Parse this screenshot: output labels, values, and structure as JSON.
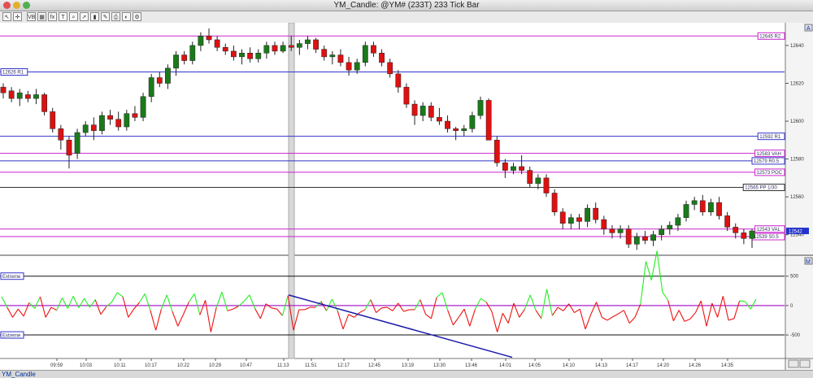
{
  "window": {
    "title": "YM_Candle: @YM# (233T) 233 Tick Bar"
  },
  "toolbar": {
    "buttons": [
      "cursor-icon",
      "crosshair-icon",
      "volume-bars-icon",
      "grid-icon",
      "fx-icon",
      "text-tool-icon",
      "zoom-icon",
      "arrow-icon",
      "bar-icon",
      "palette-icon",
      "print-icon",
      "color-icon",
      "gear-icon"
    ],
    "vb_label": "VB"
  },
  "status": {
    "tab_label": "YM_Candle"
  },
  "colors": {
    "up": "#1a7a1a",
    "down": "#dd1111",
    "osc_up": "#22ee22",
    "osc_down": "#ee1111",
    "pivot_blue": "#3333cc",
    "pivot_magenta": "#cc22cc"
  },
  "chart_data": [
    {
      "type": "candlestick",
      "ylim": [
        12530,
        12652
      ],
      "y_ticks": [
        12540,
        12560,
        12580,
        12600,
        12620,
        12640
      ],
      "x_tick_labels": [
        "09:59",
        "10:03",
        "10:11",
        "10:17",
        "10:22",
        "10:29",
        "10:47",
        "11:13",
        "11:51",
        "12:17",
        "12:45",
        "13:19",
        "13:30",
        "13:46",
        "14:01",
        "14:05",
        "14:10",
        "14:13",
        "14:17",
        "14:20",
        "14:26",
        "14:35"
      ],
      "levels": [
        {
          "label": "12645 R2",
          "value": 12645,
          "color": "#cc22cc"
        },
        {
          "label": "12626 R1",
          "value": 12626,
          "color": "#3333cc"
        },
        {
          "label": "12592 R1",
          "value": 12592,
          "color": "#3333cc"
        },
        {
          "label": "12583 VAH",
          "value": 12583,
          "color": "#cc22cc"
        },
        {
          "label": "12579 R0.5",
          "value": 12579,
          "color": "#3333cc"
        },
        {
          "label": "12573 POC",
          "value": 12573,
          "color": "#cc22cc"
        },
        {
          "label": "12565 PP 1/30",
          "value": 12565,
          "color": "#333333"
        },
        {
          "label": "12543 VAL",
          "value": 12543,
          "color": "#cc22cc"
        },
        {
          "label": "12539 S0.5",
          "value": 12539,
          "color": "#cc22cc"
        }
      ],
      "last_price": "12542",
      "axis_marker_top": "A",
      "candles": [
        [
          12618,
          12620,
          12612,
          12615
        ],
        [
          12616,
          12618,
          12610,
          12612
        ],
        [
          12612,
          12617,
          12608,
          12615
        ],
        [
          12614,
          12616,
          12610,
          12612
        ],
        [
          12612,
          12617,
          12609,
          12614
        ],
        [
          12614,
          12615,
          12603,
          12605
        ],
        [
          12605,
          12607,
          12594,
          12596
        ],
        [
          12596,
          12598,
          12585,
          12590
        ],
        [
          12590,
          12592,
          12575,
          12582
        ],
        [
          12583,
          12596,
          12580,
          12594
        ],
        [
          12594,
          12600,
          12592,
          12598
        ],
        [
          12598,
          12602,
          12590,
          12595
        ],
        [
          12595,
          12605,
          12593,
          12603
        ],
        [
          12603,
          12606,
          12598,
          12601
        ],
        [
          12601,
          12605,
          12595,
          12597
        ],
        [
          12597,
          12606,
          12595,
          12604
        ],
        [
          12604,
          12608,
          12600,
          12602
        ],
        [
          12602,
          12615,
          12600,
          12613
        ],
        [
          12613,
          12625,
          12610,
          12623
        ],
        [
          12623,
          12626,
          12618,
          12620
        ],
        [
          12620,
          12630,
          12617,
          12628
        ],
        [
          12628,
          12637,
          12624,
          12635
        ],
        [
          12635,
          12637,
          12630,
          12632
        ],
        [
          12632,
          12642,
          12630,
          12640
        ],
        [
          12640,
          12647,
          12637,
          12645
        ],
        [
          12645,
          12649,
          12641,
          12643
        ],
        [
          12643,
          12645,
          12637,
          12639
        ],
        [
          12639,
          12641,
          12635,
          12637
        ],
        [
          12637,
          12640,
          12632,
          12634
        ],
        [
          12634,
          12638,
          12630,
          12636
        ],
        [
          12636,
          12639,
          12631,
          12633
        ],
        [
          12633,
          12638,
          12631,
          12636
        ],
        [
          12636,
          12642,
          12633,
          12640
        ],
        [
          12640,
          12642,
          12635,
          12637
        ],
        [
          12637,
          12642,
          12636,
          12640
        ],
        [
          12640,
          12645,
          12637,
          12639
        ],
        [
          12639,
          12643,
          12635,
          12641
        ],
        [
          12641,
          12645,
          12638,
          12643
        ],
        [
          12643,
          12644,
          12636,
          12638
        ],
        [
          12638,
          12640,
          12632,
          12634
        ],
        [
          12634,
          12637,
          12630,
          12635
        ],
        [
          12635,
          12638,
          12629,
          12631
        ],
        [
          12631,
          12634,
          12624,
          12627
        ],
        [
          12627,
          12633,
          12625,
          12631
        ],
        [
          12631,
          12642,
          12629,
          12640
        ],
        [
          12640,
          12642,
          12634,
          12636
        ],
        [
          12636,
          12638,
          12629,
          12631
        ],
        [
          12631,
          12633,
          12623,
          12625
        ],
        [
          12625,
          12627,
          12615,
          12618
        ],
        [
          12618,
          12620,
          12607,
          12609
        ],
        [
          12609,
          12611,
          12598,
          12603
        ],
        [
          12603,
          12610,
          12600,
          12608
        ],
        [
          12608,
          12610,
          12600,
          12602
        ],
        [
          12602,
          12607,
          12598,
          12600
        ],
        [
          12600,
          12603,
          12594,
          12596
        ],
        [
          12596,
          12597,
          12590,
          12595
        ],
        [
          12595,
          12598,
          12592,
          12596
        ],
        [
          12596,
          12605,
          12594,
          12603
        ],
        [
          12603,
          12613,
          12601,
          12611
        ],
        [
          12611,
          12612,
          12590,
          12590
        ],
        [
          12590,
          12592,
          12576,
          12578
        ],
        [
          12578,
          12580,
          12570,
          12574
        ],
        [
          12574,
          12578,
          12572,
          12576
        ],
        [
          12576,
          12582,
          12572,
          12574
        ],
        [
          12574,
          12576,
          12565,
          12567
        ],
        [
          12567,
          12572,
          12564,
          12570
        ],
        [
          12570,
          12572,
          12560,
          12562
        ],
        [
          12562,
          12564,
          12550,
          12552
        ],
        [
          12552,
          12554,
          12543,
          12546
        ],
        [
          12546,
          12551,
          12543,
          12549
        ],
        [
          12549,
          12551,
          12543,
          12547
        ],
        [
          12547,
          12556,
          12544,
          12554
        ],
        [
          12554,
          12557,
          12546,
          12548
        ],
        [
          12548,
          12550,
          12540,
          12543
        ],
        [
          12543,
          12545,
          12538,
          12541
        ],
        [
          12541,
          12545,
          12538,
          12543
        ],
        [
          12543,
          12545,
          12533,
          12535
        ],
        [
          12535,
          12541,
          12532,
          12539
        ],
        [
          12539,
          12542,
          12535,
          12537
        ],
        [
          12537,
          12542,
          12534,
          12540
        ],
        [
          12540,
          12545,
          12537,
          12543
        ],
        [
          12543,
          12547,
          12540,
          12545
        ],
        [
          12545,
          12551,
          12542,
          12549
        ],
        [
          12549,
          12558,
          12547,
          12556
        ],
        [
          12556,
          12560,
          12553,
          12558
        ],
        [
          12558,
          12561,
          12550,
          12552
        ],
        [
          12552,
          12559,
          12550,
          12557
        ],
        [
          12557,
          12560,
          12548,
          12550
        ],
        [
          12550,
          12552,
          12542,
          12544
        ],
        [
          12544,
          12546,
          12538,
          12541
        ],
        [
          12541,
          12543,
          12535,
          12538
        ],
        [
          12538,
          12543,
          12533,
          12542
        ]
      ]
    },
    {
      "type": "line",
      "ylim": [
        -900,
        800
      ],
      "y_ticks": [
        500,
        0,
        -500
      ],
      "ref_labels": [
        "Extreme",
        "Extreme"
      ],
      "ref_levels": [
        500,
        -500
      ],
      "axis_marker_top": "M",
      "values": [
        150,
        -30,
        -200,
        -60,
        -180,
        50,
        -50,
        150,
        -200,
        -30,
        -80,
        130,
        -50,
        160,
        -40,
        120,
        -30,
        100,
        -150,
        -20,
        60,
        220,
        150,
        -200,
        -60,
        50,
        200,
        -80,
        -420,
        -60,
        180,
        -100,
        -350,
        -150,
        60,
        200,
        -160,
        90,
        -450,
        -30,
        230,
        -90,
        -60,
        -10,
        70,
        180,
        -50,
        -220,
        30,
        -40,
        -60,
        -170,
        170,
        -420,
        -70,
        -70,
        -30,
        -30,
        70,
        -90,
        110,
        -90,
        -400,
        -150,
        -200,
        -120,
        -70,
        100,
        -120,
        -40,
        -30,
        -90,
        40,
        -100,
        -70,
        -70,
        100,
        -150,
        -220,
        140,
        220,
        -80,
        -330,
        -200,
        -60,
        -350,
        -60,
        120,
        60,
        -100,
        -450,
        -130,
        -300,
        40,
        -200,
        -60,
        180,
        -80,
        -220,
        280,
        -170,
        -30,
        -90,
        30,
        -120,
        -60,
        -400,
        -150,
        60,
        -200,
        -250,
        -190,
        -140,
        -80,
        -300,
        -200,
        20,
        750,
        430,
        930,
        230,
        90,
        -260,
        -80,
        -270,
        -230,
        -120,
        80,
        -350,
        40,
        -200,
        160,
        -250,
        -220,
        80,
        70,
        -60,
        110
      ],
      "trend_start_value": 180,
      "trend_end_value": -880
    }
  ]
}
